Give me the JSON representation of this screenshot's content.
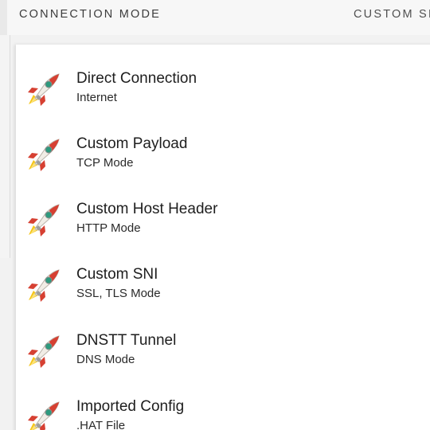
{
  "tabs": [
    {
      "label": "CONNECTION MODE"
    },
    {
      "label": "CUSTOM SI"
    }
  ],
  "modes": [
    {
      "title": "Direct Connection",
      "subtitle": "Internet",
      "icon": "rocket-icon"
    },
    {
      "title": "Custom Payload",
      "subtitle": "TCP Mode",
      "icon": "rocket-icon"
    },
    {
      "title": "Custom Host Header",
      "subtitle": "HTTP Mode",
      "icon": "rocket-icon"
    },
    {
      "title": "Custom SNI",
      "subtitle": "SSL, TLS Mode",
      "icon": "rocket-icon"
    },
    {
      "title": "DNSTT Tunnel",
      "subtitle": "DNS Mode",
      "icon": "rocket-icon"
    },
    {
      "title": "Imported Config",
      "subtitle": ".HAT File",
      "icon": "rocket-icon"
    }
  ],
  "colors": {
    "rocket_body": "#f1ede6",
    "rocket_fin": "#d64032",
    "rocket_window": "#2e9a7e",
    "flame": "#f5c518"
  }
}
